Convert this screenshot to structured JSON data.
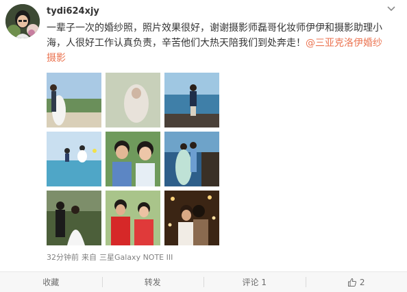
{
  "post": {
    "username": "tydi624xjy",
    "text": "一辈子一次的婚纱照，照片效果很好，谢谢摄影师磊哥化妆师伊伊和摄影助理小海，人很好工作认真负责，辛苦他们大热天陪我们到处奔走！",
    "mention": "@三亚克洛伊婚纱摄影",
    "time": "32分钟前",
    "source_prefix": "来自",
    "source": "三星Galaxy NOTE III",
    "photos": [
      "wedding-beach-couple-photo",
      "veil-closeup-photo",
      "groom-on-rocks-photo",
      "couple-jumping-sea-photo",
      "couple-with-glasses-photo",
      "couple-on-pier-photo",
      "couple-in-forest-photo",
      "couple-red-jerseys-photo",
      "couple-kiss-lights-photo"
    ]
  },
  "actions": {
    "favorite": "收藏",
    "repost": "转发",
    "comment": "评论 1",
    "like_count": "2"
  },
  "colors": {
    "mention": "#eb7350",
    "meta": "#808080",
    "actionbar_bg": "#f7f7f7"
  }
}
